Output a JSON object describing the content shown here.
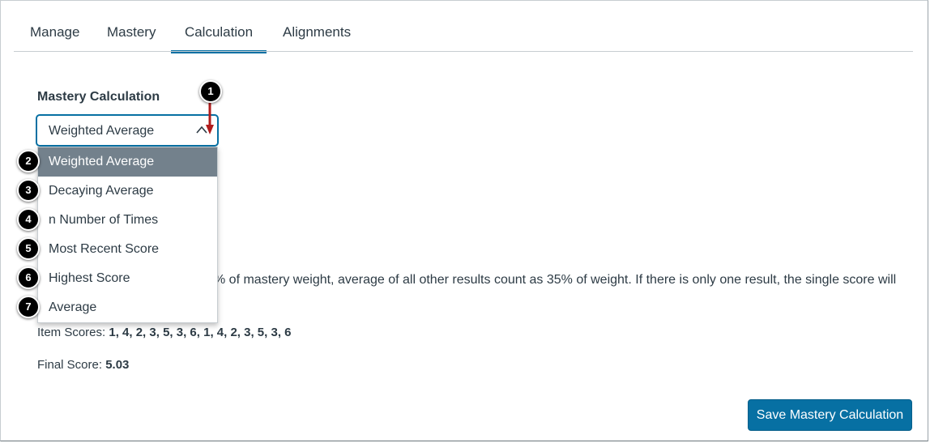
{
  "tabs": [
    {
      "label": "Manage",
      "active": false
    },
    {
      "label": "Mastery",
      "active": false
    },
    {
      "label": "Calculation",
      "active": true
    },
    {
      "label": "Alignments",
      "active": false
    }
  ],
  "mastery_calculation": {
    "label": "Mastery Calculation",
    "selected_value": "Weighted Average",
    "options": [
      {
        "label": "Weighted Average",
        "highlighted": true,
        "callout": "2"
      },
      {
        "label": "Decaying Average",
        "highlighted": false,
        "callout": "3"
      },
      {
        "label": "n Number of Times",
        "highlighted": false,
        "callout": "4"
      },
      {
        "label": "Most Recent Score",
        "highlighted": false,
        "callout": "5"
      },
      {
        "label": "Highest Score",
        "highlighted": false,
        "callout": "6"
      },
      {
        "label": "Average",
        "highlighted": false,
        "callout": "7"
      }
    ],
    "select_callout": "1"
  },
  "description_partial": "% of mastery weight, average of all other results count as 35% of weight. If there is only one result, the single score will",
  "item_scores": {
    "label": "Item Scores: ",
    "value": "1, 4, 2, 3, 5, 3, 6, 1, 4, 2, 3, 5, 3, 6"
  },
  "final_score": {
    "label": "Final Score: ",
    "value": "5.03"
  },
  "save_button": {
    "label": "Save Mastery Calculation"
  },
  "colors": {
    "accent": "#0770a3",
    "highlight_option": "#73818c",
    "callout": "#000000",
    "arrow": "#b01c1c",
    "text": "#2d3b45"
  }
}
